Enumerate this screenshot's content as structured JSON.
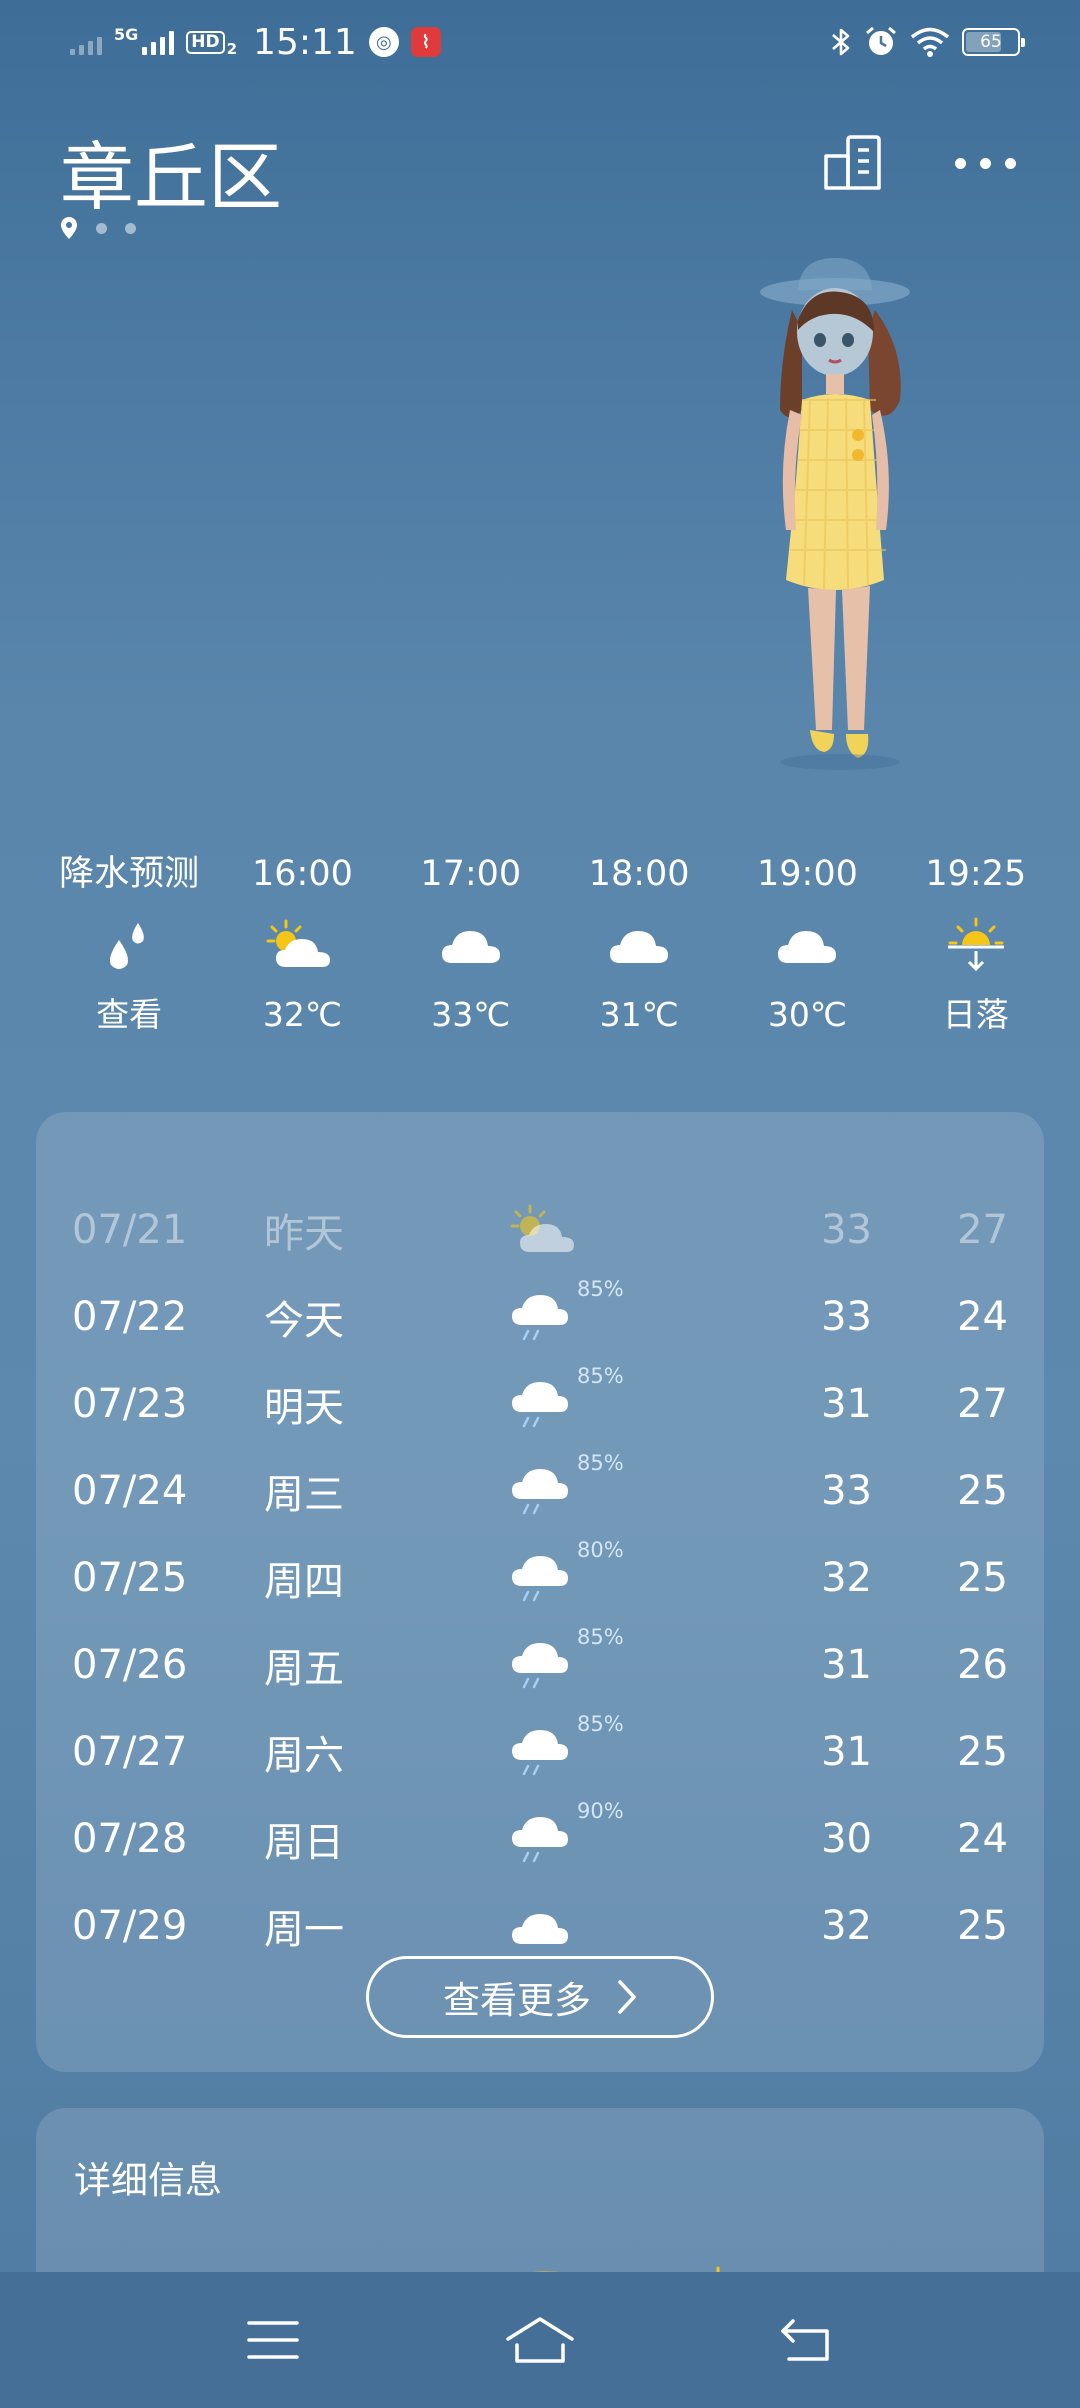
{
  "status_bar": {
    "network": "5G",
    "hd": "HD",
    "hd_sub": "2",
    "time": "15:11",
    "battery": "65"
  },
  "header": {
    "city": "章丘区"
  },
  "hourly": [
    {
      "time": "降水预测",
      "icon": "rain-drops-icon",
      "value": "查看"
    },
    {
      "time": "16:00",
      "icon": "partly-sunny-icon",
      "value": "32℃"
    },
    {
      "time": "17:00",
      "icon": "cloud-icon",
      "value": "33℃"
    },
    {
      "time": "18:00",
      "icon": "cloud-icon",
      "value": "31℃"
    },
    {
      "time": "19:00",
      "icon": "cloud-icon",
      "value": "30℃"
    },
    {
      "time": "19:25",
      "icon": "sunset-icon",
      "value": "日落"
    }
  ],
  "forecast": [
    {
      "date": "07/21",
      "day": "昨天",
      "icon": "partly-sunny-icon",
      "pct": "",
      "high": "33",
      "low": "27"
    },
    {
      "date": "07/22",
      "day": "今天",
      "icon": "rain-icon",
      "pct": "85%",
      "high": "33",
      "low": "24"
    },
    {
      "date": "07/23",
      "day": "明天",
      "icon": "rain-icon",
      "pct": "85%",
      "high": "31",
      "low": "27"
    },
    {
      "date": "07/24",
      "day": "周三",
      "icon": "rain-icon",
      "pct": "85%",
      "high": "33",
      "low": "25"
    },
    {
      "date": "07/25",
      "day": "周四",
      "icon": "rain-icon",
      "pct": "80%",
      "high": "32",
      "low": "25"
    },
    {
      "date": "07/26",
      "day": "周五",
      "icon": "rain-icon",
      "pct": "85%",
      "high": "31",
      "low": "26"
    },
    {
      "date": "07/27",
      "day": "周六",
      "icon": "rain-icon",
      "pct": "85%",
      "high": "31",
      "low": "25"
    },
    {
      "date": "07/28",
      "day": "周日",
      "icon": "rain-icon",
      "pct": "90%",
      "high": "30",
      "low": "24"
    },
    {
      "date": "07/29",
      "day": "周一",
      "icon": "cloud-icon",
      "pct": "",
      "high": "32",
      "low": "25"
    }
  ],
  "more_button": {
    "label": "查看更多"
  },
  "details": {
    "title": "详细信息"
  },
  "colors": {
    "background": "#5a86ac",
    "sun": "#f5c518",
    "navbar": "#456f96"
  }
}
